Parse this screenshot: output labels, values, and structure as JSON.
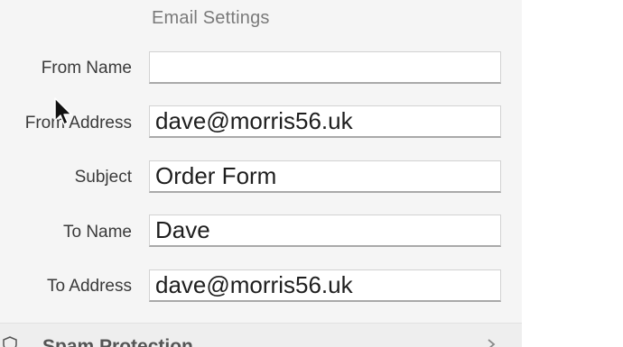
{
  "section": {
    "title": "Email Settings"
  },
  "fields": {
    "from_name": {
      "label": "From Name",
      "value": ""
    },
    "from_address": {
      "label": "From Address",
      "value": "dave@morris56.uk"
    },
    "subject": {
      "label": "Subject",
      "value": "Order Form"
    },
    "to_name": {
      "label": "To Name",
      "value": "Dave"
    },
    "to_address": {
      "label": "To Address",
      "value": "dave@morris56.uk"
    }
  },
  "footer": {
    "label": "Spam Protection",
    "icon": "shield-icon",
    "chevron": "chevron-right-icon"
  },
  "colors": {
    "panel_bg": "#f5f5f5",
    "title_text": "#7a7a7a",
    "label_text": "#3a3a3a"
  }
}
